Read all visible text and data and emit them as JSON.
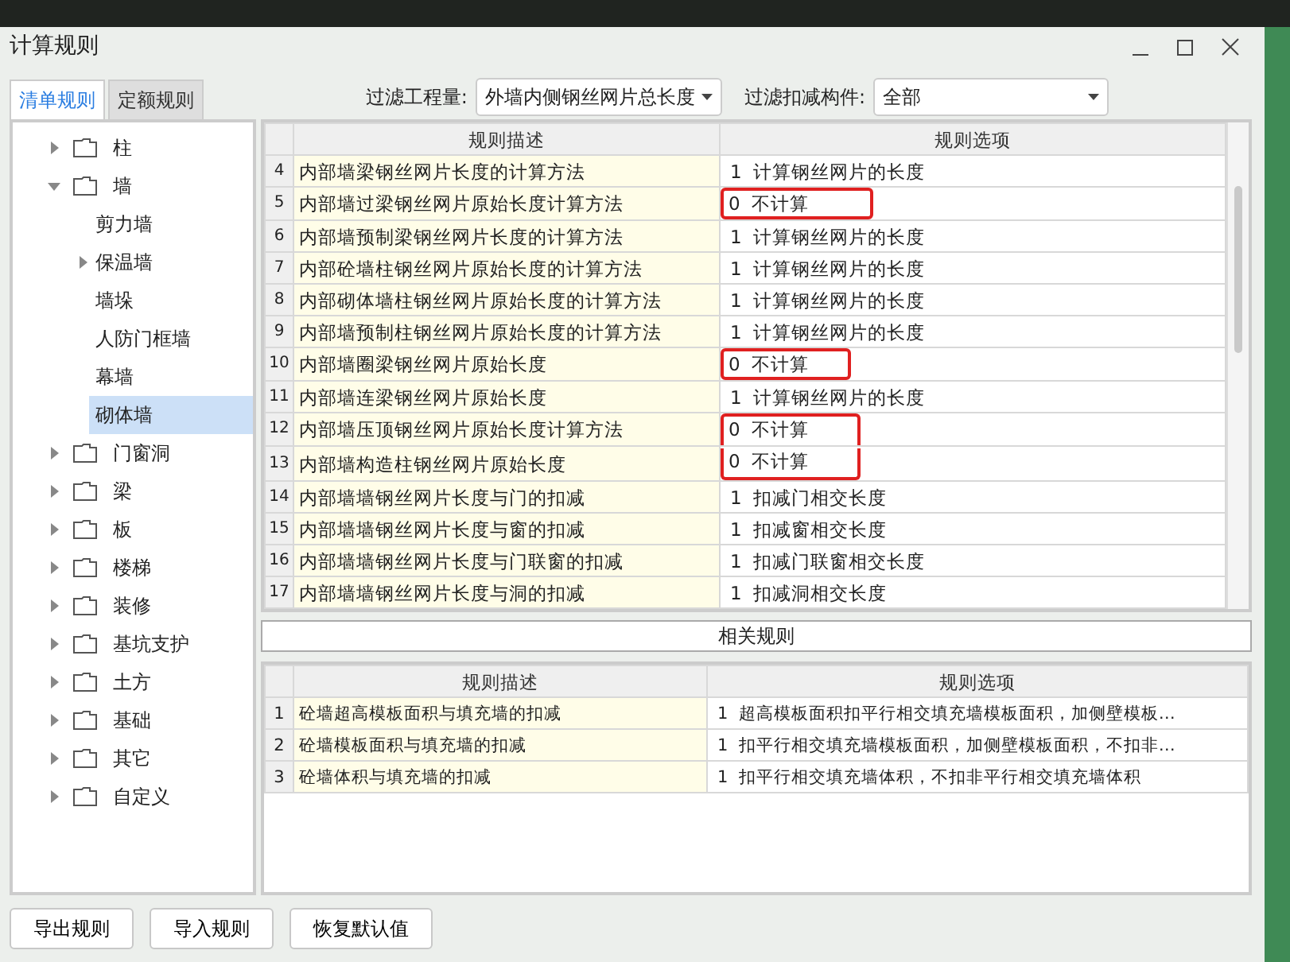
{
  "window": {
    "title": "计算规则"
  },
  "tabs": [
    {
      "label": "清单规则",
      "selected": true
    },
    {
      "label": "定额规则",
      "selected": false
    }
  ],
  "filters": [
    {
      "label": "过滤工程量:",
      "value": "外墙内侧钢丝网片总长度"
    },
    {
      "label": "过滤扣减构件:",
      "value": "全部"
    }
  ],
  "tree": [
    {
      "label": "柱",
      "kind": "folder",
      "expanded": false,
      "selected": false
    },
    {
      "label": "墙",
      "kind": "folder",
      "expanded": true,
      "selected": false,
      "children": [
        {
          "label": "剪力墙",
          "kind": "leaf",
          "selected": false
        },
        {
          "label": "保温墙",
          "kind": "group",
          "selected": false
        },
        {
          "label": "墙垛",
          "kind": "leaf",
          "selected": false
        },
        {
          "label": "人防门框墙",
          "kind": "leaf",
          "selected": false
        },
        {
          "label": "幕墙",
          "kind": "leaf",
          "selected": false
        },
        {
          "label": "砌体墙",
          "kind": "leaf",
          "selected": true
        }
      ]
    },
    {
      "label": "门窗洞",
      "kind": "folder",
      "expanded": false,
      "selected": false
    },
    {
      "label": "梁",
      "kind": "folder",
      "expanded": false,
      "selected": false
    },
    {
      "label": "板",
      "kind": "folder",
      "expanded": false,
      "selected": false
    },
    {
      "label": "楼梯",
      "kind": "folder",
      "expanded": false,
      "selected": false
    },
    {
      "label": "装修",
      "kind": "folder",
      "expanded": false,
      "selected": false
    },
    {
      "label": "基坑支护",
      "kind": "folder",
      "expanded": false,
      "selected": false
    },
    {
      "label": "土方",
      "kind": "folder",
      "expanded": false,
      "selected": false
    },
    {
      "label": "基础",
      "kind": "folder",
      "expanded": false,
      "selected": false
    },
    {
      "label": "其它",
      "kind": "folder",
      "expanded": false,
      "selected": false
    },
    {
      "label": "自定义",
      "kind": "folder",
      "expanded": false,
      "selected": false
    }
  ],
  "rules_table": {
    "columns": [
      "规则描述",
      "规则选项"
    ],
    "rows": [
      {
        "index": "4",
        "description": "内部墙梁钢丝网片长度的计算方法",
        "code": "1",
        "option": "计算钢丝网片的长度",
        "highlighted": false
      },
      {
        "index": "5",
        "description": "内部墙过梁钢丝网片原始长度计算方法",
        "code": "0",
        "option": "不计算",
        "highlighted": true
      },
      {
        "index": "6",
        "description": "内部墙预制梁钢丝网片长度的计算方法",
        "code": "1",
        "option": "计算钢丝网片的长度",
        "highlighted": false
      },
      {
        "index": "7",
        "description": "内部砼墙柱钢丝网片原始长度的计算方法",
        "code": "1",
        "option": "计算钢丝网片的长度",
        "highlighted": false
      },
      {
        "index": "8",
        "description": "内部砌体墙柱钢丝网片原始长度的计算方法",
        "code": "1",
        "option": "计算钢丝网片的长度",
        "highlighted": false
      },
      {
        "index": "9",
        "description": "内部墙预制柱钢丝网片原始长度的计算方法",
        "code": "1",
        "option": "计算钢丝网片的长度",
        "highlighted": false
      },
      {
        "index": "10",
        "description": "内部墙圈梁钢丝网片原始长度",
        "code": "0",
        "option": "不计算",
        "highlighted": true
      },
      {
        "index": "11",
        "description": "内部墙连梁钢丝网片原始长度",
        "code": "1",
        "option": "计算钢丝网片的长度",
        "highlighted": false
      },
      {
        "index": "12",
        "description": "内部墙压顶钢丝网片原始长度计算方法",
        "code": "0",
        "option": "不计算",
        "highlighted": true
      },
      {
        "index": "13",
        "description": "内部墙构造柱钢丝网片原始长度",
        "code": "0",
        "option": "不计算",
        "highlighted": true
      },
      {
        "index": "14",
        "description": "内部墙墙钢丝网片长度与门的扣减",
        "code": "1",
        "option": "扣减门相交长度",
        "highlighted": false
      },
      {
        "index": "15",
        "description": "内部墙墙钢丝网片长度与窗的扣减",
        "code": "1",
        "option": "扣减窗相交长度",
        "highlighted": false
      },
      {
        "index": "16",
        "description": "内部墙墙钢丝网片长度与门联窗的扣减",
        "code": "1",
        "option": "扣减门联窗相交长度",
        "highlighted": false
      },
      {
        "index": "17",
        "description": "内部墙墙钢丝网片长度与洞的扣减",
        "code": "1",
        "option": "扣减洞相交长度",
        "highlighted": false
      }
    ]
  },
  "related_header": "相关规则",
  "related_table": {
    "columns": [
      "规则描述",
      "规则选项"
    ],
    "rows": [
      {
        "index": "1",
        "description": "砼墙超高模板面积与填充墙的扣减",
        "code": "1",
        "option": "超高模板面积扣平行相交填充墙模板面积，加侧壁模板…"
      },
      {
        "index": "2",
        "description": "砼墙模板面积与填充墙的扣减",
        "code": "1",
        "option": "扣平行相交填充墙模板面积，加侧壁模板面积，不扣非…"
      },
      {
        "index": "3",
        "description": "砼墙体积与填充墙的扣减",
        "code": "1",
        "option": "扣平行相交填充墙体积，不扣非平行相交填充墙体积"
      }
    ]
  },
  "buttons": [
    "导出规则",
    "导入规则",
    "恢复默认值"
  ]
}
